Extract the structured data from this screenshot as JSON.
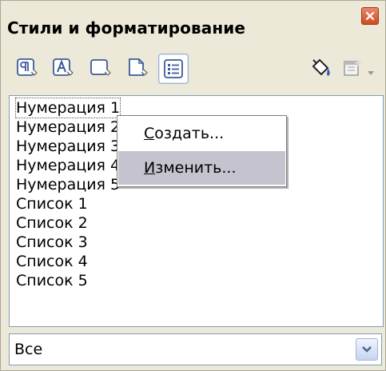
{
  "window": {
    "title": "Стили и форматирование"
  },
  "toolbar": {
    "buttons": [
      {
        "name": "paragraph-styles",
        "icon": "paragraph-styles-icon"
      },
      {
        "name": "character-styles",
        "icon": "character-styles-icon"
      },
      {
        "name": "frame-styles",
        "icon": "frame-styles-icon"
      },
      {
        "name": "page-styles",
        "icon": "page-styles-icon"
      },
      {
        "name": "list-styles",
        "icon": "list-styles-icon",
        "active": true
      },
      {
        "name": "fill-format-mode",
        "icon": "paint-bucket-icon"
      },
      {
        "name": "new-style-from-selection",
        "icon": "new-style-icon"
      }
    ]
  },
  "list": {
    "items": [
      "Нумерация 1",
      "Нумерация 2",
      "Нумерация 3",
      "Нумерация 4",
      "Нумерация 5",
      "Список 1",
      "Список 2",
      "Список 3",
      "Список 4",
      "Список 5"
    ],
    "selected_index": 0
  },
  "context_menu": {
    "items": [
      {
        "label_accel": "С",
        "label_rest": "оздать..."
      },
      {
        "label_accel": "И",
        "label_rest": "зменить...",
        "hover": true
      }
    ]
  },
  "filter": {
    "value": "Все"
  }
}
